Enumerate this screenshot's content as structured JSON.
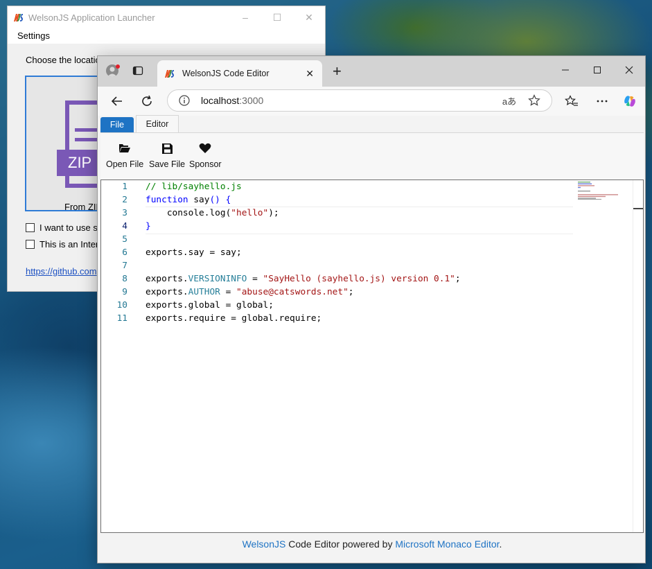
{
  "launcher": {
    "title": "WelsonJS Application Launcher",
    "menu": {
      "settings": "Settings"
    },
    "prompt": "Choose the locatio",
    "zip_badge": "ZIP",
    "from_zip": "From ZIP",
    "checkbox1": "I want to use sp",
    "checkbox2": "This is an Inter",
    "link": "https://github.com"
  },
  "browser": {
    "tab_title": "WelsonJS Code Editor",
    "url_host": "localhost",
    "url_port": ":3000",
    "read_aloud_glyph": "aあ"
  },
  "page": {
    "tabs": {
      "file": "File",
      "editor": "Editor"
    },
    "ribbon": {
      "open": "Open File",
      "save": "Save File",
      "sponsor": "Sponsor"
    },
    "footer": {
      "link1": "WelsonJS",
      "mid": " Code Editor powered by ",
      "link2": "Microsoft Monaco Editor",
      "end": "."
    }
  },
  "editor": {
    "line_numbers": [
      "1",
      "2",
      "3",
      "4",
      "5",
      "6",
      "7",
      "8",
      "9",
      "10",
      "11"
    ],
    "lines": [
      {
        "parts": [
          {
            "t": "// lib/sayhello.js",
            "c": "c-com"
          }
        ]
      },
      {
        "parts": [
          {
            "t": "function",
            "c": "c-kw"
          },
          {
            "t": " say",
            "c": ""
          },
          {
            "t": "() {",
            "c": "c-kw"
          }
        ]
      },
      {
        "parts": [
          {
            "t": "    console.log(",
            "c": ""
          },
          {
            "t": "\"hello\"",
            "c": "c-str"
          },
          {
            "t": ");",
            "c": ""
          }
        ]
      },
      {
        "parts": [
          {
            "t": "}",
            "c": "c-kw"
          }
        ]
      },
      {
        "parts": []
      },
      {
        "parts": [
          {
            "t": "exports.say = say;",
            "c": ""
          }
        ]
      },
      {
        "parts": []
      },
      {
        "parts": [
          {
            "t": "exports.",
            "c": ""
          },
          {
            "t": "VERSIONINFO",
            "c": "c-prop"
          },
          {
            "t": " = ",
            "c": ""
          },
          {
            "t": "\"SayHello (sayhello.js) version 0.1\"",
            "c": "c-str"
          },
          {
            "t": ";",
            "c": ""
          }
        ]
      },
      {
        "parts": [
          {
            "t": "exports.",
            "c": ""
          },
          {
            "t": "AUTHOR",
            "c": "c-prop"
          },
          {
            "t": " = ",
            "c": ""
          },
          {
            "t": "\"abuse@catswords.net\"",
            "c": "c-str"
          },
          {
            "t": ";",
            "c": ""
          }
        ]
      },
      {
        "parts": [
          {
            "t": "exports.global = global;",
            "c": ""
          }
        ]
      },
      {
        "parts": [
          {
            "t": "exports.require = global.require;",
            "c": ""
          }
        ]
      }
    ],
    "current_line": 4
  },
  "colors": {
    "accent": "#1e73c4",
    "zip_purple": "#7a58b6",
    "comment": "#008000",
    "keyword": "#0000ff",
    "string": "#a31515",
    "property": "#267f99"
  },
  "icons": {
    "profile": "profile-icon",
    "tab_actions": "tab-actions-icon",
    "back": "back-arrow-icon",
    "refresh": "refresh-icon",
    "info": "site-info-icon",
    "favorite": "star-icon",
    "favorites_bar": "favorites-icon",
    "more": "more-icon",
    "copilot": "copilot-icon",
    "open": "folder-open-icon",
    "save": "floppy-disk-icon",
    "sponsor": "heart-icon"
  }
}
